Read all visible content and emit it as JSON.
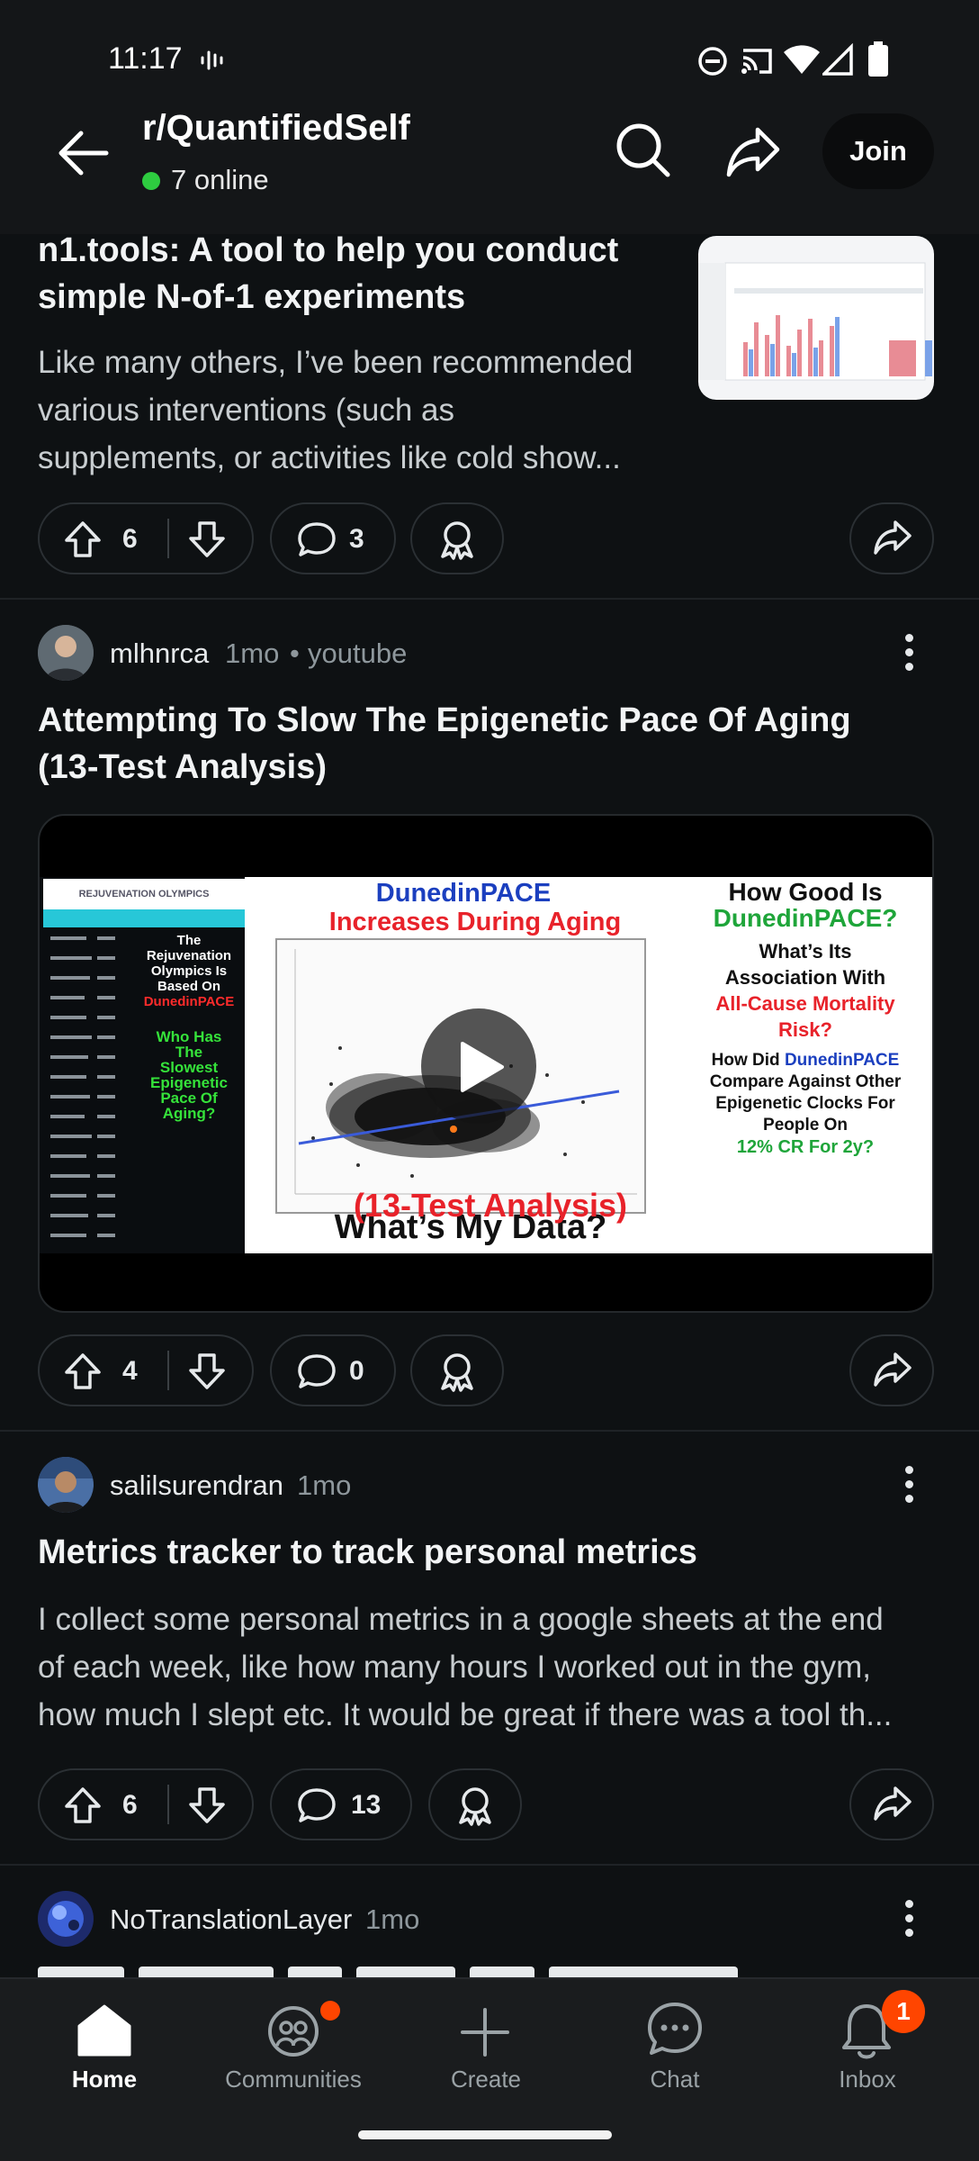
{
  "status_bar": {
    "time": "11:17"
  },
  "header": {
    "subreddit": "r/QuantifiedSelf",
    "online": "7 online",
    "join_label": "Join"
  },
  "posts": [
    {
      "title_line1": "n1.tools: A tool to help you conduct",
      "title_line2": "simple N-of-1 experiments",
      "body_line1": "Like many others, I’ve been recommended",
      "body_line2": "various interventions (such as",
      "body_line3": "supplements, or activities like cold show...",
      "votes": "6",
      "comments": "3"
    },
    {
      "user": "mlhnrca",
      "time": "1mo",
      "source": "youtube",
      "title_line1": "Attempting To Slow The Epigenetic Pace Of Aging",
      "title_line2": "(13-Test Analysis)",
      "votes": "4",
      "comments": "0",
      "thumb": {
        "brand": "REJUVENATION OLYMPICS",
        "left_line1": "The",
        "left_line2": "Rejuvenation",
        "left_line3": "Olympics Is",
        "left_line4": "Based On",
        "left_line5": "DunedinPACE",
        "left_q1": "Who Has",
        "left_q2": "The",
        "left_q3": "Slowest",
        "left_q4": "Epigenetic",
        "left_q5": "Pace Of",
        "left_q6": "Aging?",
        "center_title1": "DunedinPACE",
        "center_title2": "Increases During Aging",
        "bottom1": "What’s My Data?",
        "bottom2": "(13-Test Analysis)",
        "right1": "How Good Is",
        "right2": "DunedinPACE?",
        "right3": "What’s Its",
        "right4": "Association With",
        "right5": "All-Cause Mortality",
        "right6": "Risk?",
        "right7": "How Did",
        "right7b": "DunedinPACE",
        "right8": "Compare Against Other",
        "right9": "Epigenetic Clocks For",
        "right10": "People On",
        "right11": "12% CR For 2y?"
      }
    },
    {
      "user": "salilsurendran",
      "time": "1mo",
      "title": "Metrics tracker to track personal metrics",
      "body_line1": "I collect some personal metrics in a google sheets at the end",
      "body_line2": "of each week, like how many hours I worked out in the gym,",
      "body_line3": "how much I slept etc. It would be great if there was a tool th...",
      "votes": "6",
      "comments": "13"
    },
    {
      "user": "NoTranslationLayer",
      "time": "1mo"
    }
  ],
  "nav": {
    "items": [
      "Home",
      "Communities",
      "Create",
      "Chat",
      "Inbox"
    ],
    "inbox_badge": "1"
  },
  "colors": {
    "background": "#0e1113",
    "online": "#2ecc40",
    "badge": "#ff4500"
  }
}
